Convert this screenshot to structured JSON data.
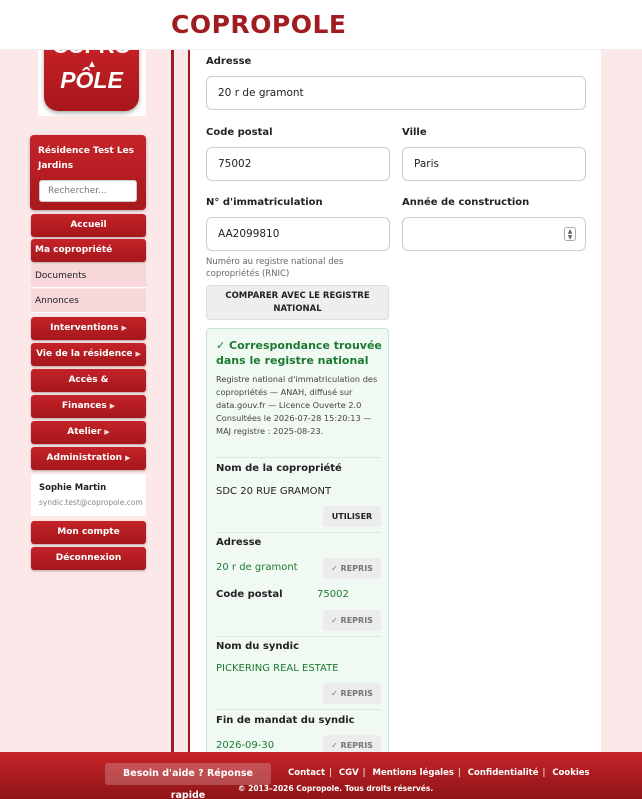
{
  "app": {
    "title": "COPROPOLE"
  },
  "logo": {
    "line1": "COPRO",
    "line2": "PÔLE"
  },
  "sidebar": {
    "residence": "Résidence Test Les Jardins",
    "search_placeholder": "Rechercher...",
    "items": [
      {
        "label": "Accueil"
      },
      {
        "label": "Ma copropriété"
      },
      {
        "label": "Documents"
      },
      {
        "label": "Annonces"
      },
      {
        "label": "Interventions",
        "caret": "▶"
      },
      {
        "label": "Vie de la résidence",
        "caret": "▶"
      },
      {
        "label": "Accès & Équipements",
        "caret": "▶"
      },
      {
        "label": "Finances",
        "caret": "▶"
      },
      {
        "label": "Atelier",
        "caret": "▶"
      },
      {
        "label": "Administration",
        "caret": "▶"
      }
    ],
    "user": {
      "name": "Sophie Martin",
      "email": "syndic.test@copropole.com"
    },
    "account": "Mon compte",
    "logout": "Déconnexion"
  },
  "form": {
    "address_label": "Adresse",
    "address_value": "20 r de gramont",
    "postal_label": "Code postal",
    "postal_value": "75002",
    "city_label": "Ville",
    "city_value": "Paris",
    "immat_label": "N° d'immatriculation",
    "immat_value": "AA2099810",
    "year_label": "Année de construction",
    "year_value": "",
    "immat_hint": "Numéro au registre national des copropriétés (RNIC)",
    "compare_button": "COMPARER AVEC LE REGISTRE NATIONAL"
  },
  "match": {
    "title": "✓ Correspondance trouvée dans le registre national",
    "desc": "Registre national d'immatriculation des copropriétés — ANAH, diffusé sur data.gouv.fr — Licence Ouverte 2.0",
    "consulted": "Consultées le 2026-07-28 15:20:13 — MAJ registre : 2025-08-23.",
    "fields": [
      {
        "key": "Nom de la copropriété",
        "value": "SDC 20 RUE GRAMONT",
        "action": "UTILISER"
      },
      {
        "key": "Adresse",
        "value": "20 r de gramont",
        "action": "✓ REPRIS"
      },
      {
        "key": "Code postal",
        "value": "75002",
        "action": "✓ REPRIS"
      },
      {
        "key": "Nom du syndic",
        "value": "PICKERING REAL ESTATE",
        "action": "✓ REPRIS"
      },
      {
        "key": "Fin de mandat du syndic",
        "value": "2026-09-30",
        "action": "✓ REPRIS"
      }
    ]
  },
  "footer": {
    "help": "Besoin d'aide ? Réponse rapide",
    "links": [
      "Contact",
      "CGV",
      "Mentions légales",
      "Confidentialité",
      "Cookies"
    ],
    "separator": "|",
    "copyright": "© 2013–2026 Copropole. Tous droits réservés."
  },
  "colors": {
    "brand": "#a01c20",
    "success": "#1b7a32"
  }
}
